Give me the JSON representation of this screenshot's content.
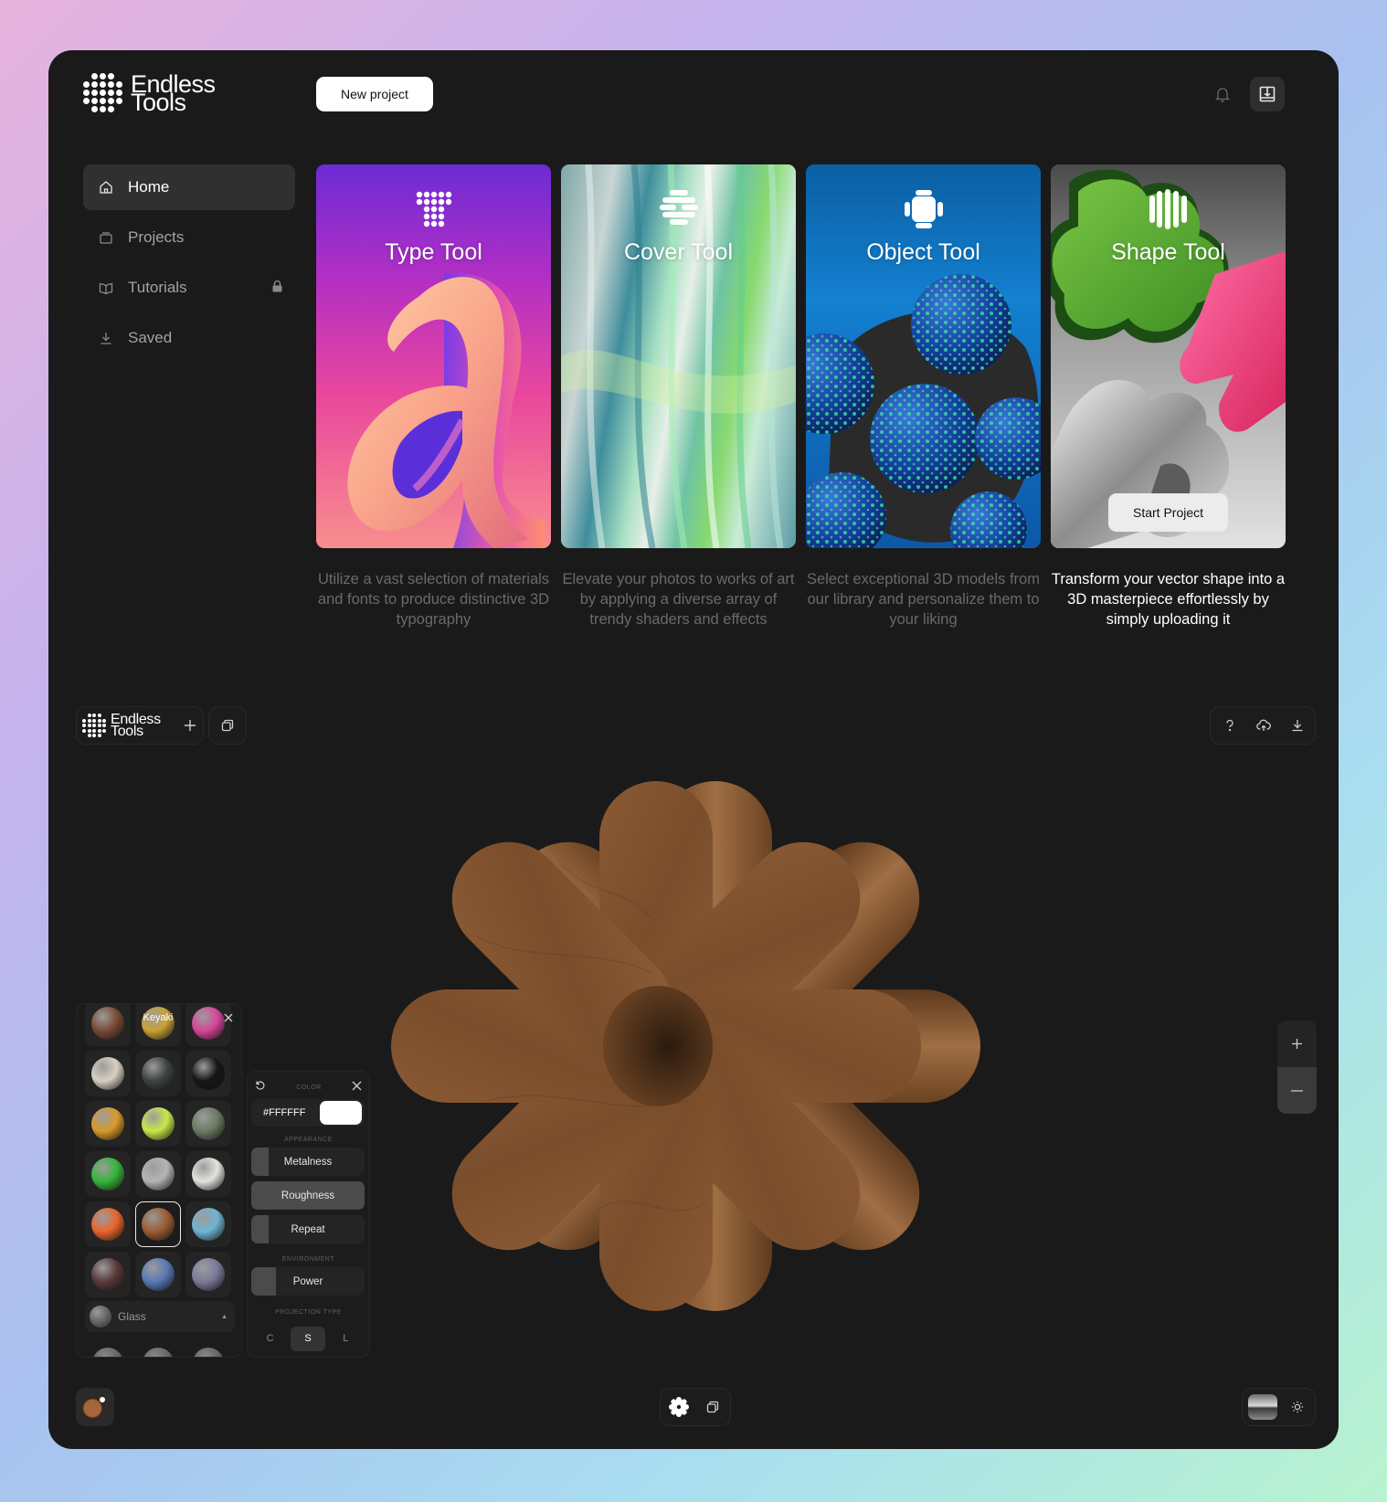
{
  "brand": {
    "name_line1": "Endless",
    "name_line2": "Tools"
  },
  "header": {
    "new_project_label": "New project"
  },
  "nav": {
    "items": [
      {
        "label": "Home",
        "icon": "home-icon",
        "active": true
      },
      {
        "label": "Projects",
        "icon": "projects-icon",
        "active": false
      },
      {
        "label": "Tutorials",
        "icon": "book-open-icon",
        "active": false,
        "locked": true
      },
      {
        "label": "Saved",
        "icon": "download-icon",
        "active": false
      }
    ]
  },
  "tools": [
    {
      "title": "Type Tool",
      "description": "Utilize a vast selection of materials and fonts to produce distinctive 3D typography"
    },
    {
      "title": "Cover Tool",
      "description": "Elevate your photos to works of art by applying a diverse array of trendy shaders and effects"
    },
    {
      "title": "Object Tool",
      "description": "Select exceptional 3D models from our library and personalize them to your liking"
    },
    {
      "title": "Shape Tool",
      "description": "Transform your vector shape into a 3D masterpiece effortlessly by simply uploading it",
      "button_label": "Start Project",
      "highlighted": true
    }
  ],
  "editor": {
    "brand_line1": "Endless",
    "brand_line2": "Tools",
    "top_right_icons": [
      "help-icon",
      "cloud-upload-icon",
      "download-icon"
    ],
    "palette": {
      "swatch_label": "Keyaki",
      "swatches": [
        "#7a4a36",
        "#c9a233",
        "#d6459a",
        "#d9cfc1",
        "#3d4440",
        "#161616",
        "#d89a2a",
        "#c8e84a",
        "#6c7a62",
        "#35b53b",
        "#b4b4b4",
        "#e4e2dc",
        "#e8652b",
        "#9b5d33",
        "#6fb4d3",
        "#593939",
        "#5878b4",
        "#7a7a9a"
      ],
      "selected_index": 13,
      "category": "Glass"
    },
    "color_panel": {
      "header_label": "COLOR",
      "hex": "#FFFFFF",
      "swatch_color": "#ffffff",
      "appearance_label": "APPEARANCE",
      "sliders": [
        {
          "label": "Metalness",
          "value": 0.15
        },
        {
          "label": "Roughness",
          "value": 1.0
        },
        {
          "label": "Repeat",
          "value": 0.15
        }
      ],
      "environment_label": "ENVIRONMENT",
      "environment_sliders": [
        {
          "label": "Power",
          "value": 0.22
        }
      ],
      "projection_label": "PROJECTION TYPE",
      "projection_options": [
        "C",
        "S",
        "L"
      ],
      "projection_selected": "S"
    }
  }
}
